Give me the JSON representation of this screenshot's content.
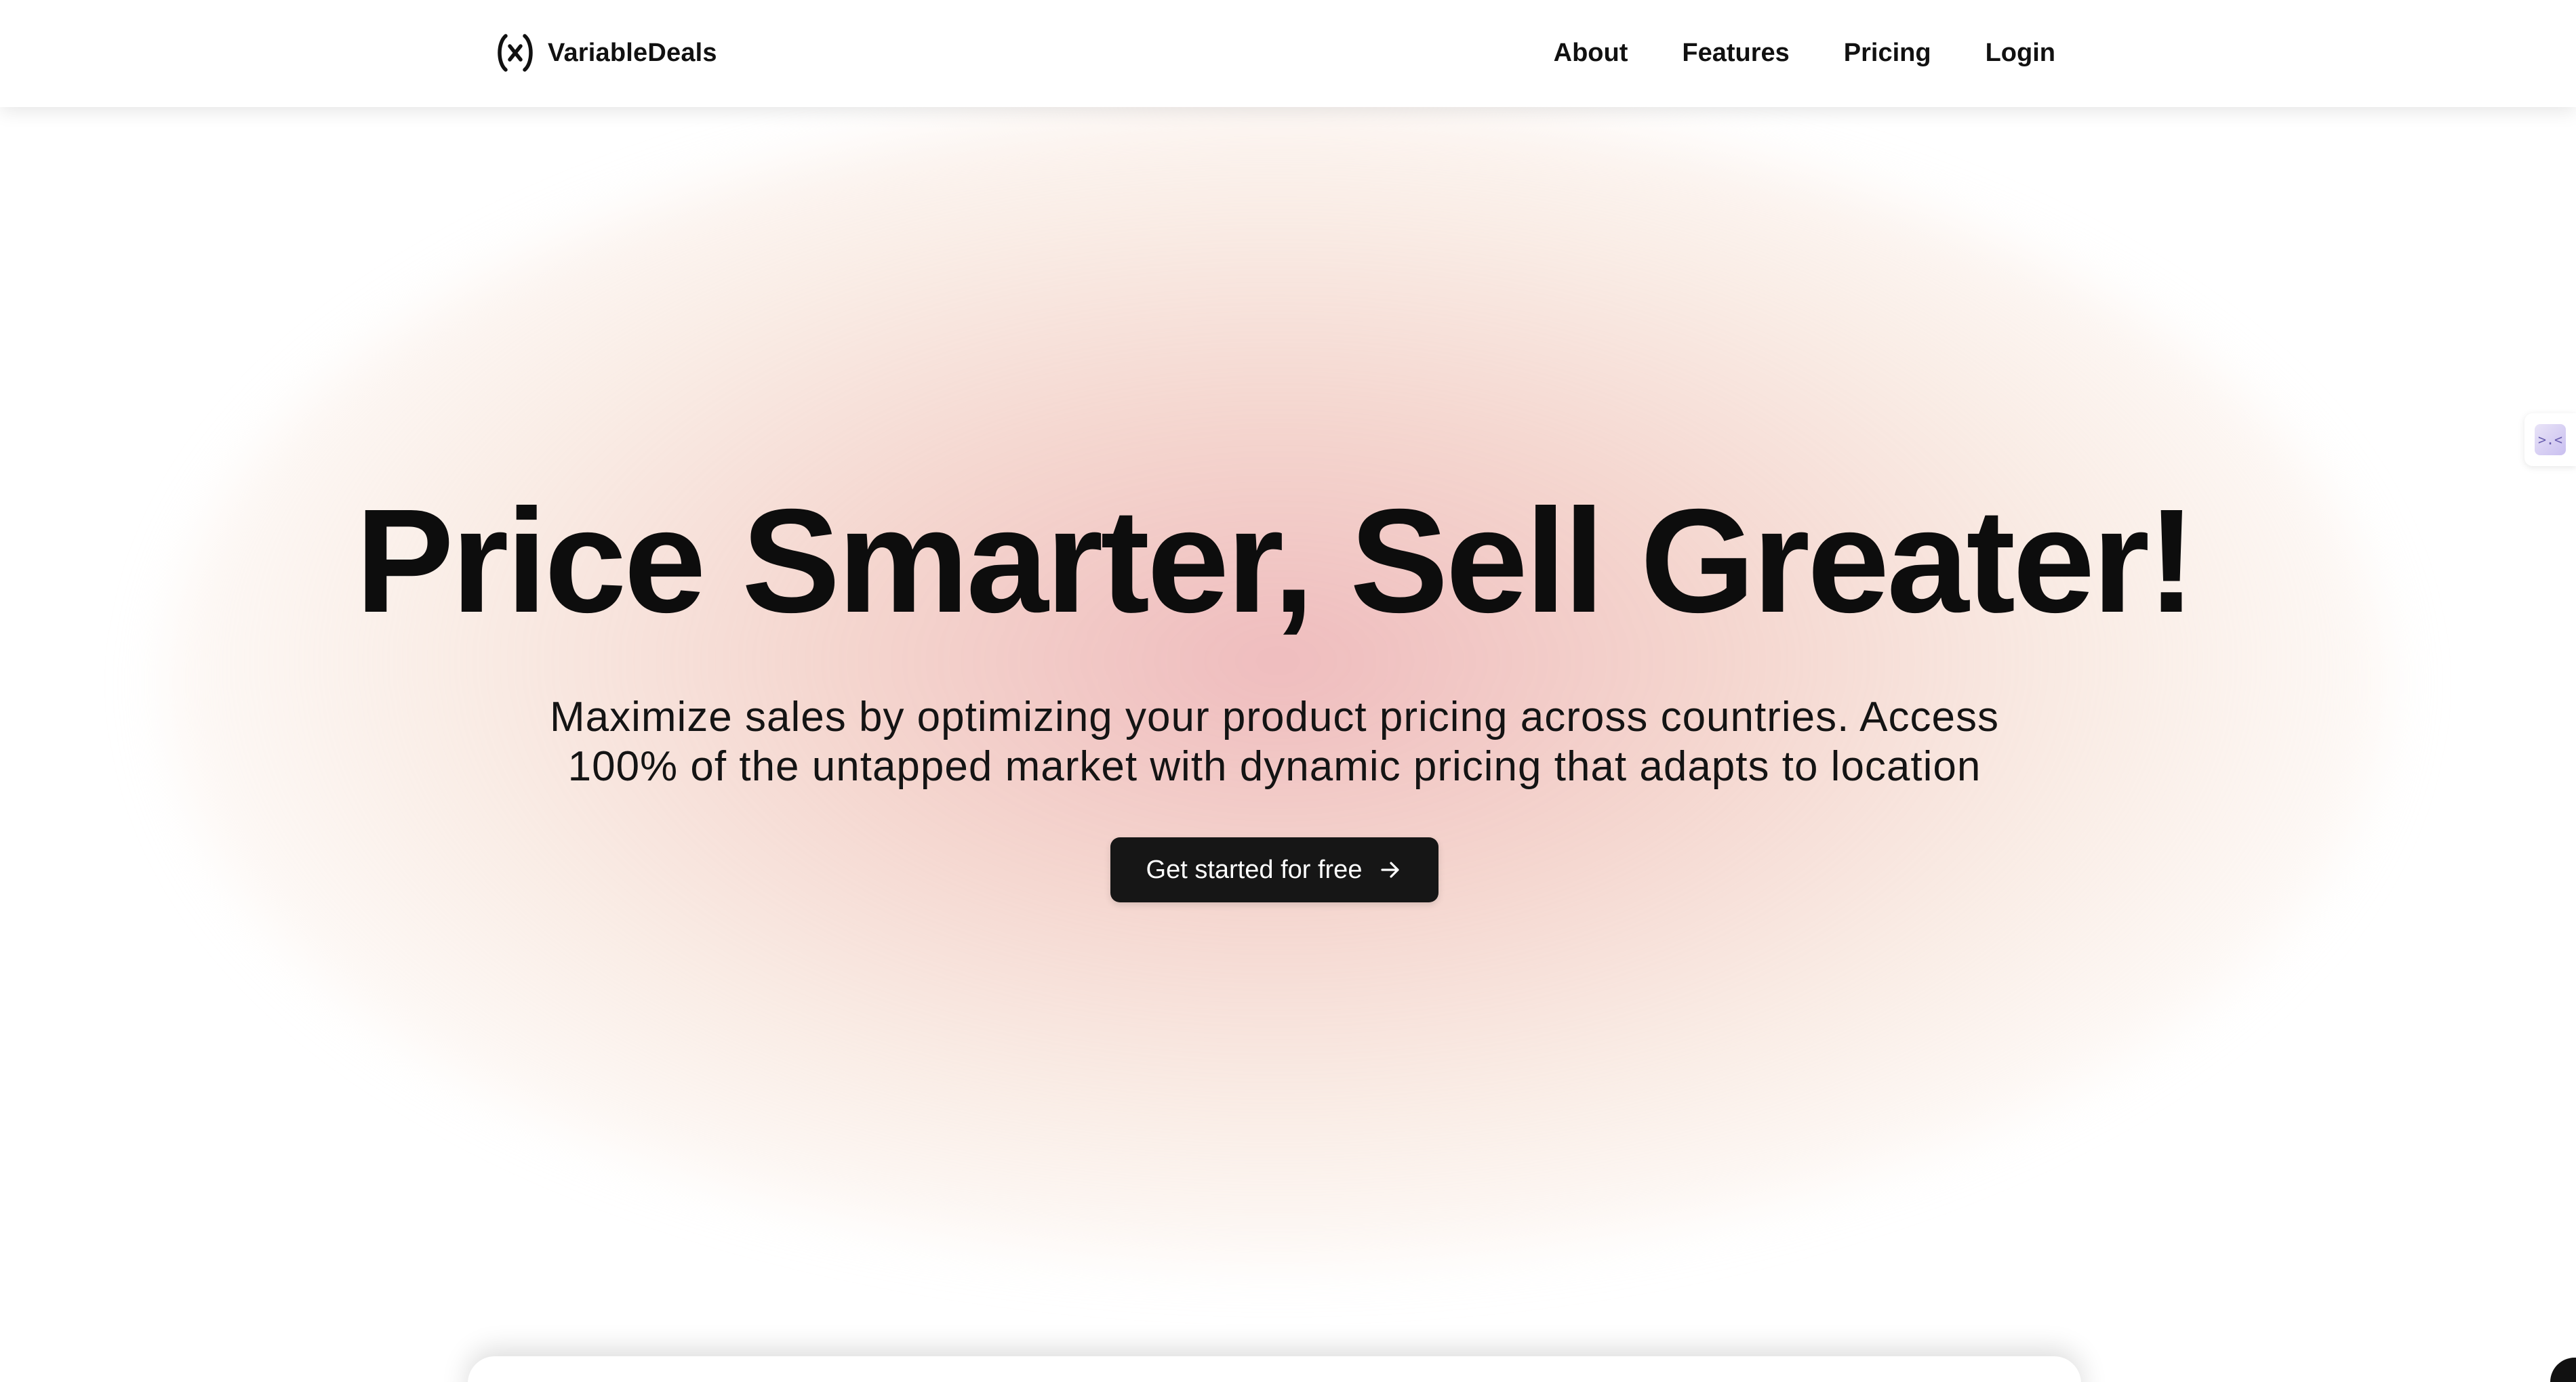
{
  "header": {
    "brand_name": "VariableDeals",
    "brand_icon": "variable-x-icon",
    "nav": [
      {
        "label": "About"
      },
      {
        "label": "Features"
      },
      {
        "label": "Pricing"
      },
      {
        "label": "Login"
      }
    ]
  },
  "hero": {
    "title": "Price Smarter, Sell Greater!",
    "subtitle": "Maximize sales by optimizing your product pricing across countries. Access 100% of the untapped market with dynamic pricing that adapts to location",
    "cta_label": "Get started for free",
    "cta_icon": "arrow-right-icon"
  },
  "side_widget": {
    "icon": "code-widget-icon",
    "glyph": ">.<"
  },
  "colors": {
    "background": "#ffffff",
    "text": "#111111",
    "cta_background": "#161616",
    "cta_text": "#ffffff",
    "glow_pink": "#ecb0b2",
    "glow_peach": "#f4dacc"
  }
}
